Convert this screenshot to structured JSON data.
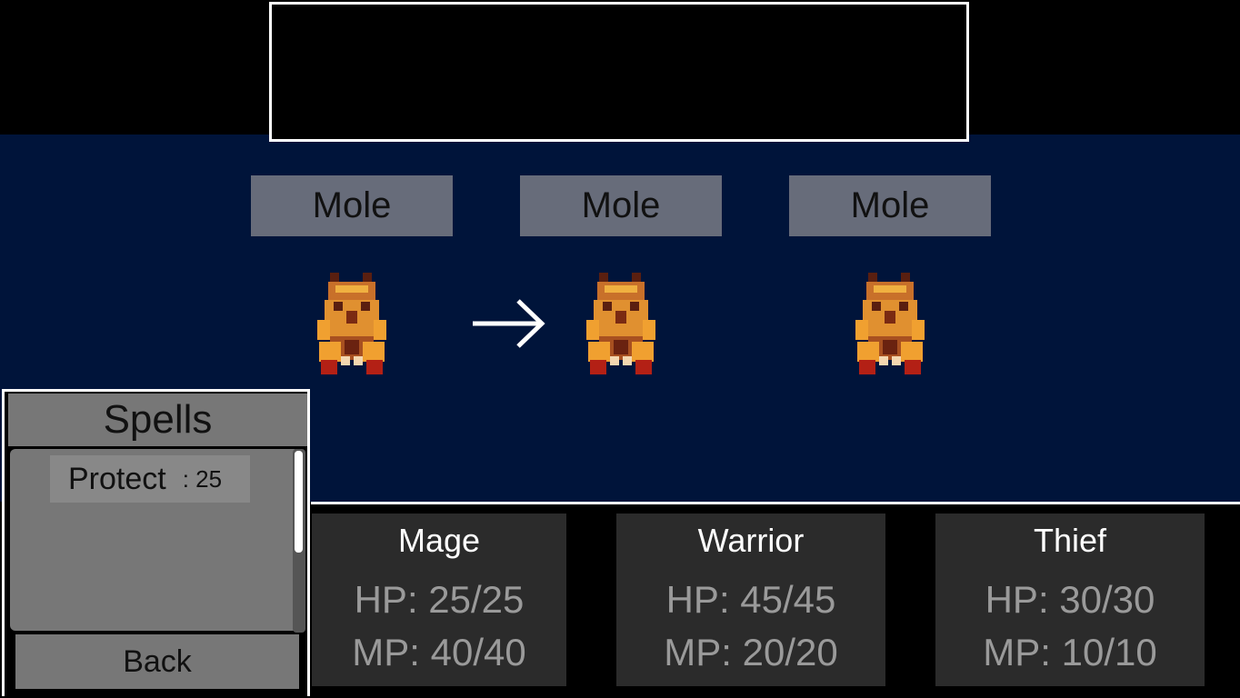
{
  "message_box": {
    "text": ""
  },
  "enemies": [
    {
      "name": "Mole"
    },
    {
      "name": "Mole"
    },
    {
      "name": "Mole"
    }
  ],
  "target_arrow": {
    "icon": "right-arrow-icon",
    "targeted_enemy_index": 1
  },
  "spell_menu": {
    "title": "Spells",
    "spells": [
      {
        "name": "Protect",
        "cost": ": 25"
      }
    ],
    "back_label": "Back"
  },
  "party": [
    {
      "name": "Mage",
      "hp": "HP: 25/25",
      "mp": "MP: 40/40"
    },
    {
      "name": "Warrior",
      "hp": "HP: 45/45",
      "mp": "MP: 20/20"
    },
    {
      "name": "Thief",
      "hp": "HP: 30/30",
      "mp": "MP: 10/10"
    }
  ],
  "colors": {
    "battlefield": "#00143a",
    "enemy_label_bg": "#676c7a",
    "panel_gray": "#777777",
    "party_card_bg": "#2b2b2b",
    "sprite_body": "#e09030",
    "sprite_dark": "#5a1f10",
    "sprite_claw": "#b32015"
  }
}
